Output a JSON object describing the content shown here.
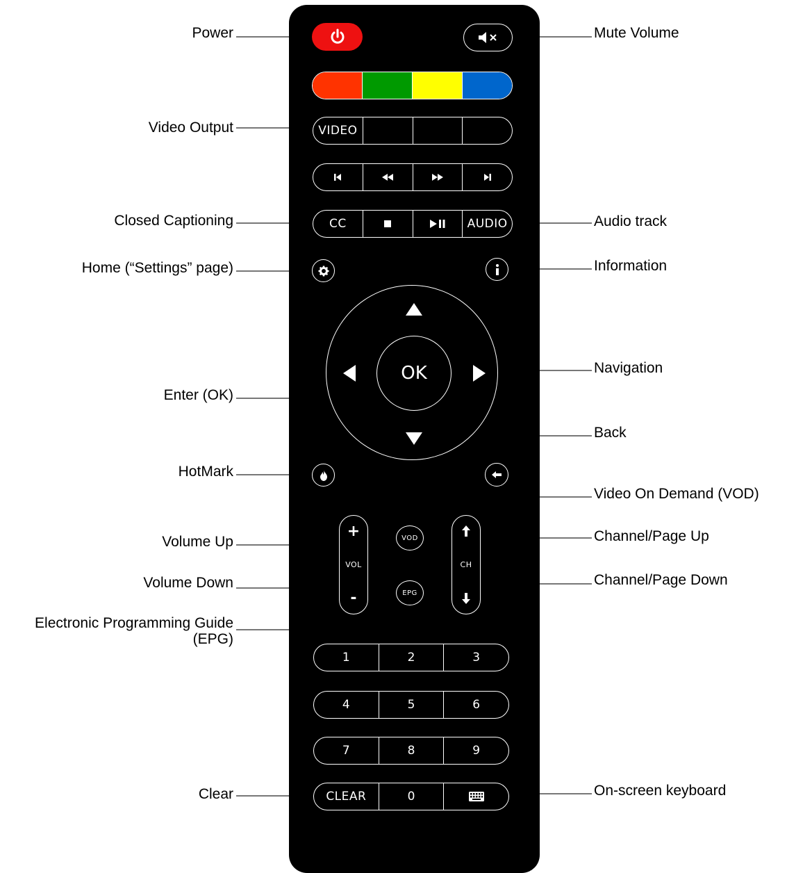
{
  "labels": {
    "power": "Power",
    "mute": "Mute Volume",
    "video_output": "Video Output",
    "closed_captioning": "Closed Captioning",
    "audio_track": "Audio track",
    "home": "Home (“Settings” page)",
    "information": "Information",
    "navigation": "Navigation",
    "enter": "Enter (OK)",
    "back": "Back",
    "hotmark": "HotMark",
    "vod": "Video On Demand (VOD)",
    "volume_up": "Volume Up",
    "channel_up": "Channel/Page Up",
    "volume_down": "Volume Down",
    "channel_down": "Channel/Page Down",
    "epg_line1": "Electronic Programming Guide",
    "epg_line2": "(EPG)",
    "clear": "Clear",
    "keyboard": "On-screen keyboard"
  },
  "remote": {
    "video": "VIDEO",
    "cc": "CC",
    "audio": "AUDIO",
    "ok": "OK",
    "vod": "VOD",
    "epg": "EPG",
    "vol": "VOL",
    "ch": "CH",
    "plus": "+",
    "minus": "-",
    "clear": "CLEAR",
    "digits": [
      "1",
      "2",
      "3",
      "4",
      "5",
      "6",
      "7",
      "8",
      "9",
      "0"
    ],
    "colors": [
      "#ff3300",
      "#009a00",
      "#ffff00",
      "#0066cc"
    ],
    "power_color": "#ee1111"
  }
}
